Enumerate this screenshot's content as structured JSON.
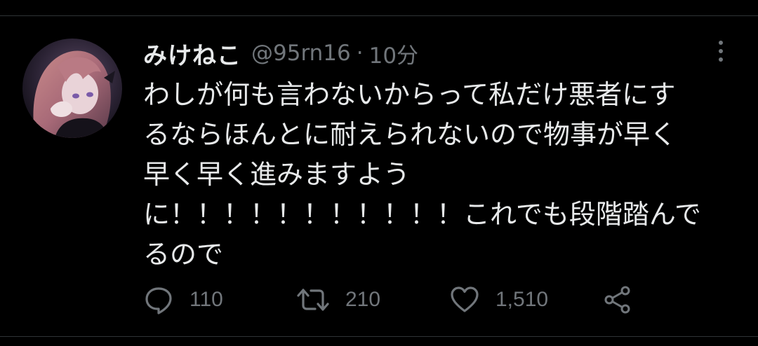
{
  "tweet": {
    "display_name": "みけねこ",
    "handle": "@95rn16",
    "separator": "·",
    "timestamp": "10分",
    "text_lines": [
      "わしが何も言わないからって私だけ悪者にす",
      "るならほんとに耐えられないので物事が早く",
      "早く早く進みますよう",
      "に！！！！！！！！！！！これでも段階踏んで",
      "るので"
    ],
    "actions": {
      "reply": {
        "icon": "reply-icon",
        "count": "110"
      },
      "retweet": {
        "icon": "retweet-icon",
        "count": "210"
      },
      "like": {
        "icon": "heart-icon",
        "count": "1,510"
      },
      "share": {
        "icon": "share-icon"
      }
    },
    "more_icon": "more-vertical-icon",
    "avatar_icon": "avatar-image"
  },
  "colors": {
    "background": "#000000",
    "text_primary": "#e7e9ea",
    "text_secondary": "#71767b",
    "divider": "#2f3336"
  }
}
